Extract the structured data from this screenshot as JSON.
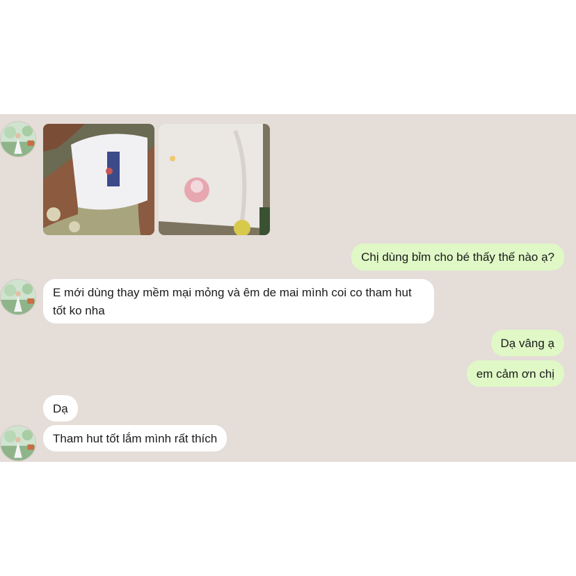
{
  "conversation": {
    "messages": [
      {
        "sender": "contact",
        "type": "photos",
        "photos": [
          "baby-diaper-photo",
          "diaper-pack-photo"
        ]
      },
      {
        "sender": "me",
        "text": "Chị dùng bỉm cho bé thấy thế nào ạ?"
      },
      {
        "sender": "contact",
        "text": "E mới dùng thay mềm mại mỏng và êm de mai mình coi co tham hut tốt ko nha"
      },
      {
        "sender": "me",
        "text": "Dạ vâng ạ"
      },
      {
        "sender": "me",
        "text": "em cảm ơn chị"
      },
      {
        "sender": "contact",
        "text": "Dạ"
      },
      {
        "sender": "contact",
        "text": "Tham hut tốt lắm mình rất thích"
      }
    ]
  },
  "colors": {
    "chat_background": "#e5ddd8",
    "incoming_bubble": "#ffffff",
    "outgoing_bubble": "#dff8c6"
  }
}
